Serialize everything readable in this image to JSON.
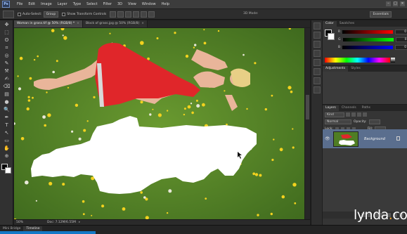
{
  "app": {
    "logo": "Ps",
    "menus": [
      "File",
      "Edit",
      "Image",
      "Layer",
      "Type",
      "Select",
      "Filter",
      "3D",
      "View",
      "Window",
      "Help"
    ],
    "window_controls": [
      "–",
      "□",
      "×"
    ]
  },
  "options_bar": {
    "auto_select_label": "Auto-Select:",
    "auto_select_value": "Group",
    "show_transform_label": "Show Transform Controls",
    "mode_3d_label": "3D Mode:",
    "workspace": "Essentials"
  },
  "tools": {
    "glyphs": [
      "✥",
      "⬚",
      "ʘ",
      "⌗",
      "◎",
      "✎",
      "⚒",
      "✍",
      "⌫",
      "▤",
      "●",
      "🔍",
      "✒",
      "T",
      "↖",
      "▭",
      "✋",
      "⊕"
    ]
  },
  "documents": {
    "tabs": [
      {
        "label": "Woman in grass.tif @ 50% (RGB/8) *",
        "active": true
      },
      {
        "label": "Block of grass.jpg @ 50% (RGB/8)",
        "active": false
      }
    ],
    "close_glyph": "×"
  },
  "status": {
    "zoom": "50%",
    "doc_size": "Doc: 7.12M/6.55M",
    "arrow": "▸"
  },
  "bottom_tabs": [
    "Mini Bridge",
    "Timeline"
  ],
  "color_panel": {
    "tabs": [
      "Color",
      "Swatches"
    ],
    "sliders": [
      {
        "label": "R",
        "value": "0"
      },
      {
        "label": "G",
        "value": "0"
      },
      {
        "label": "B",
        "value": "0"
      }
    ],
    "foreground": "#000000",
    "background": "#ffffff"
  },
  "adjustments_panel": {
    "tabs": [
      "Adjustments",
      "Styles"
    ]
  },
  "layers_panel": {
    "tabs": [
      "Layers",
      "Channels",
      "Paths"
    ],
    "kind": "Kind",
    "blend_mode": "Normal",
    "opacity_label": "Opacity:",
    "lock_label": "Lock:",
    "fill_label": "Fill:",
    "layers": [
      {
        "name": "Background",
        "visible": true,
        "locked": true,
        "selected": true
      }
    ]
  },
  "watermark": {
    "text": "lynda",
    "dot": ".",
    "suffix": "com"
  }
}
